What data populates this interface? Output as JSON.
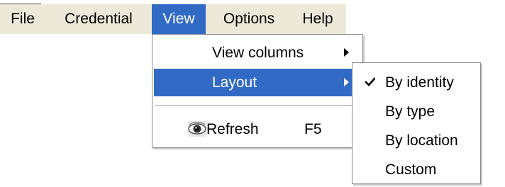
{
  "menubar": {
    "file_label": "File",
    "credential_label": "Credential",
    "view_label": "View",
    "options_label": "Options",
    "help_label": "Help"
  },
  "view_menu": {
    "view_columns_label": "View columns",
    "layout_label": "Layout",
    "refresh_label": "Refresh",
    "refresh_shortcut": "F5",
    "refresh_icon": "eye-icon"
  },
  "layout_menu": {
    "items": [
      {
        "label": "By identity",
        "checked": true
      },
      {
        "label": "By type",
        "checked": false
      },
      {
        "label": "By location",
        "checked": false
      },
      {
        "label": "Custom",
        "checked": false
      }
    ],
    "check_icon": "checkmark-icon"
  },
  "colors": {
    "menubar_background": "#ece9d8",
    "highlight": "#316ac5",
    "highlight_text": "#ffffff",
    "menu_background": "#ffffff"
  }
}
